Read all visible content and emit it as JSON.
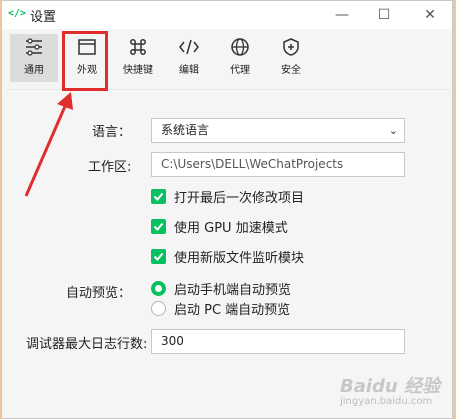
{
  "window": {
    "title": "设置",
    "app_icon": "</>",
    "controls": {
      "minimize": "—",
      "maximize": "☐",
      "close": "✕"
    }
  },
  "toolbar": {
    "items": [
      {
        "label": "通用",
        "icon": "sliders-icon",
        "active": true
      },
      {
        "label": "外观",
        "icon": "window-icon",
        "active": false
      },
      {
        "label": "快捷键",
        "icon": "command-icon",
        "active": false
      },
      {
        "label": "编辑",
        "icon": "code-icon",
        "active": false
      },
      {
        "label": "代理",
        "icon": "globe-icon",
        "active": false
      },
      {
        "label": "安全",
        "icon": "shield-plus-icon",
        "active": false
      }
    ]
  },
  "settings": {
    "language": {
      "label": "语言：",
      "value": "系统语言"
    },
    "workspace": {
      "label": "工作区:",
      "value": "C:\\Users\\DELL\\WeChatProjects"
    },
    "checkboxes": [
      {
        "label": "打开最后一次修改项目",
        "checked": true
      },
      {
        "label": "使用 GPU 加速模式",
        "checked": true
      },
      {
        "label": "使用新版文件监听模块",
        "checked": true
      }
    ],
    "auto_preview": {
      "label": "自动预览：",
      "options": [
        {
          "label": "启动手机端自动预览",
          "selected": true
        },
        {
          "label": "启动 PC 端自动预览",
          "selected": false
        }
      ]
    },
    "debugger_log": {
      "label": "调试器最大日志行数:",
      "value": "300"
    }
  },
  "watermark": {
    "brand": "Baidu 经验",
    "sub": "jingyan.baidu.com"
  },
  "colors": {
    "accent": "#07c160",
    "annotation": "#e02e2e"
  }
}
